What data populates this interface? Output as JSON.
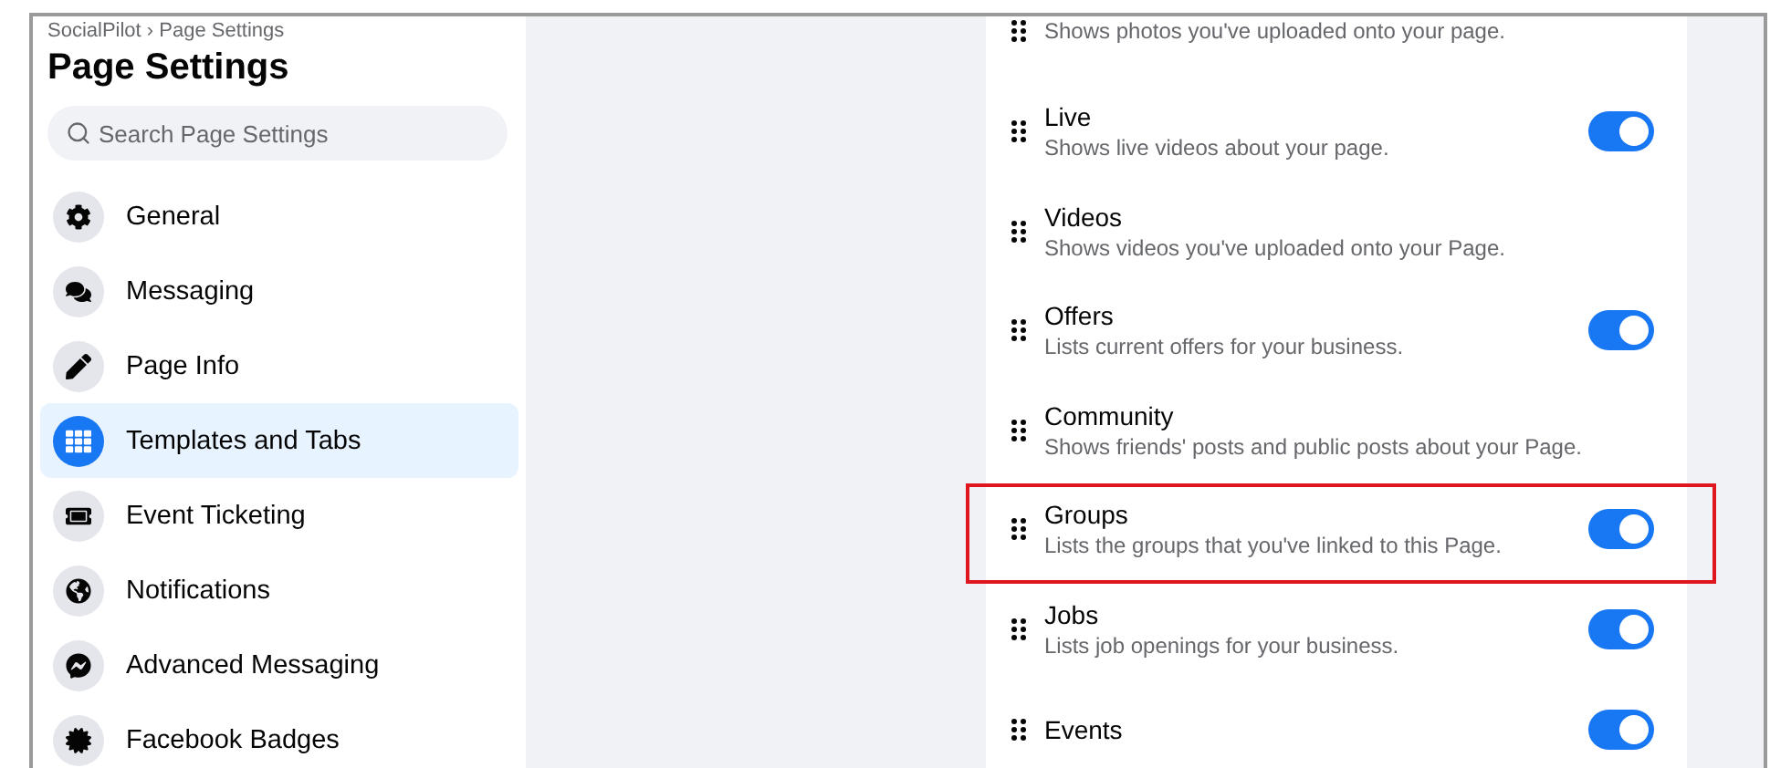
{
  "breadcrumb": "SocialPilot › Page Settings",
  "title": "Page Settings",
  "search": {
    "placeholder": "Search Page Settings"
  },
  "sidebar": {
    "items": [
      {
        "label": "General",
        "selected": false
      },
      {
        "label": "Messaging",
        "selected": false
      },
      {
        "label": "Page Info",
        "selected": false
      },
      {
        "label": "Templates and Tabs",
        "selected": true
      },
      {
        "label": "Event Ticketing",
        "selected": false
      },
      {
        "label": "Notifications",
        "selected": false
      },
      {
        "label": "Advanced Messaging",
        "selected": false
      },
      {
        "label": "Facebook Badges",
        "selected": false
      }
    ]
  },
  "tabs": [
    {
      "kind": "fixed",
      "description": "Shows photos you've uploaded onto your page."
    },
    {
      "kind": "toggle",
      "title": "Live",
      "description": "Shows live videos about your page.",
      "on": true
    },
    {
      "kind": "fixed",
      "title": "Videos",
      "description": "Shows videos you've uploaded onto your Page."
    },
    {
      "kind": "toggle",
      "title": "Offers",
      "description": "Lists current offers for your business.",
      "on": true
    },
    {
      "kind": "fixed",
      "title": "Community",
      "description": "Shows friends' posts and public posts about your Page."
    },
    {
      "kind": "toggle",
      "title": "Groups",
      "description": "Lists the groups that you've linked to this Page.",
      "on": true,
      "highlighted": true
    },
    {
      "kind": "toggle",
      "title": "Jobs",
      "description": "Lists job openings for your business.",
      "on": true
    },
    {
      "kind": "toggle",
      "title": "Events",
      "on": true
    }
  ]
}
